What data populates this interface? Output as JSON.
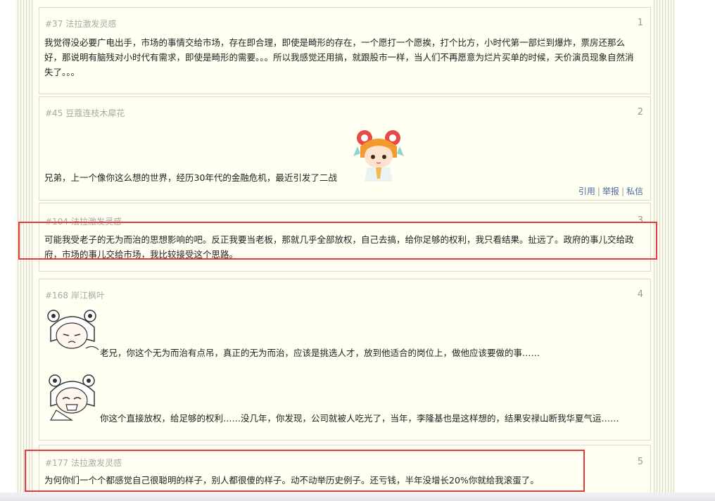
{
  "posts": [
    {
      "pid": "#37",
      "author": "法拉激发灵感",
      "floor": "1",
      "text": "我觉得没必要广电出手，市场的事情交给市场，存在即合理，即使是畸形的存在，一个愿打一个愿挨，打个比方，小时代第一部烂到爆炸，票房还那么好，那说明有脑残对小时代有需求，即使是畸形的需要。。。所以我感觉还用搞，就跟股市一样，当人们不再愿意为烂片买单的时候，天价演员现象自然消失了。。。"
    },
    {
      "pid": "#45",
      "author": "豆蔻连枝木犀花",
      "floor": "2",
      "text": "兄弟，上一个像你这么想的世界，经历30年代的金融危机，最近引发了二战",
      "actions": [
        "引用",
        "举报",
        "私信"
      ]
    },
    {
      "pid": "#104",
      "author": "法拉激发灵感",
      "floor": "3",
      "text": "可能我受老子的无为而治的思想影响的吧。反正我要当老板，那就几乎全部放权，自己去搞，给你足够的权利，我只看结果。扯远了。政府的事儿交给政府，市场的事儿交给市场，我比较接受这个思路。"
    },
    {
      "pid": "#168",
      "author": "岸江枫叶",
      "floor": "4",
      "text1": "老兄，你这个无为而治有点吊，真正的无为而治，应该是挑选人才，放到他适合的岗位上，做他应该要做的事……",
      "text2": "你这个直接放权，给足够的权利……没几年，你发现，公司就被人吃光了，当年，李隆基也是这样想的，结果安禄山断我华夏气运……"
    },
    {
      "pid": "#177",
      "author": "法拉激发灵感",
      "floor": "5",
      "text": "为何你们一个个都感觉自己很聪明的样子，别人都很傻的样子。动不动举历史例子。还亏钱，半年没增长20%你就给我滚蛋了。"
    }
  ],
  "colors": {
    "highlight": "#e8383d",
    "post_bg": "#fffff2",
    "action_link": "#4a6aa0"
  },
  "icons": [
    "anime-girl-sticker",
    "crying-girl-sticker",
    "fan-girl-sticker"
  ]
}
